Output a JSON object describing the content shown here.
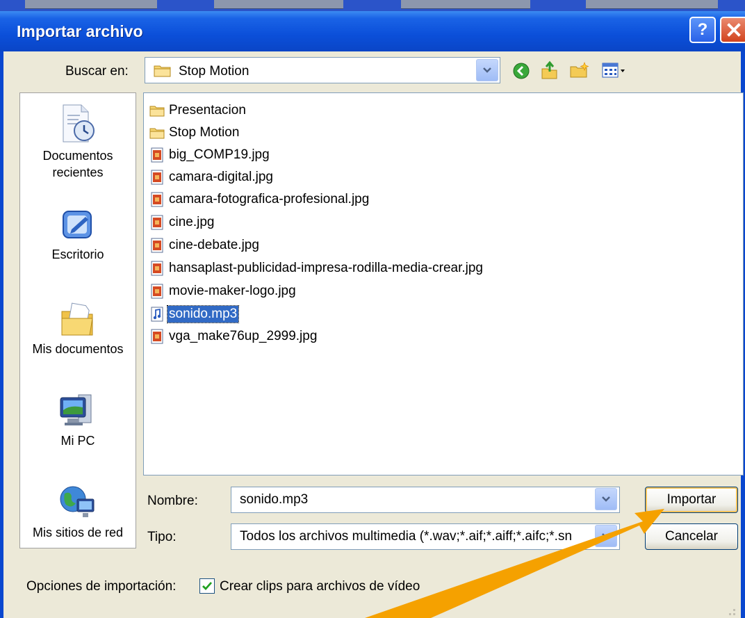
{
  "dialog": {
    "title": "Importar archivo",
    "help_label": "?",
    "close_label": "✕"
  },
  "lookin": {
    "label": "Buscar en:",
    "value": "Stop Motion"
  },
  "toolbar": {
    "icons": [
      "back-icon",
      "up-folder-icon",
      "new-folder-icon",
      "view-menu-icon"
    ]
  },
  "places": [
    {
      "label": "Documentos recientes",
      "icon": "recent-documents-icon"
    },
    {
      "label": "Escritorio",
      "icon": "desktop-icon"
    },
    {
      "label": "Mis documentos",
      "icon": "my-documents-icon"
    },
    {
      "label": "Mi PC",
      "icon": "my-computer-icon"
    },
    {
      "label": "Mis sitios de red",
      "icon": "network-places-icon"
    }
  ],
  "files": [
    {
      "name": "Presentacion",
      "type": "folder"
    },
    {
      "name": "Stop Motion",
      "type": "folder"
    },
    {
      "name": "big_COMP19.jpg",
      "type": "image"
    },
    {
      "name": "camara-digital.jpg",
      "type": "image"
    },
    {
      "name": "camara-fotografica-profesional.jpg",
      "type": "image"
    },
    {
      "name": "cine.jpg",
      "type": "image"
    },
    {
      "name": "cine-debate.jpg",
      "type": "image"
    },
    {
      "name": "hansaplast-publicidad-impresa-rodilla-media-crear.jpg",
      "type": "image"
    },
    {
      "name": "movie-maker-logo.jpg",
      "type": "image"
    },
    {
      "name": "sonido.mp3",
      "type": "audio",
      "selected": true
    },
    {
      "name": "vga_make76up_2999.jpg",
      "type": "image"
    }
  ],
  "filename": {
    "label": "Nombre:",
    "value": "sonido.mp3"
  },
  "filetype": {
    "label": "Tipo:",
    "value": "Todos los archivos multimedia (*.wav;*.aif;*.aiff;*.aifc;*.sn"
  },
  "buttons": {
    "import": "Importar",
    "cancel": "Cancelar"
  },
  "options": {
    "label": "Opciones de importación:",
    "checkbox_label": "Crear clips para archivos de vídeo",
    "checked": true
  },
  "colors": {
    "titlebar": "#0b4fd9",
    "selection": "#316ac5",
    "arrow": "#f5a100"
  }
}
